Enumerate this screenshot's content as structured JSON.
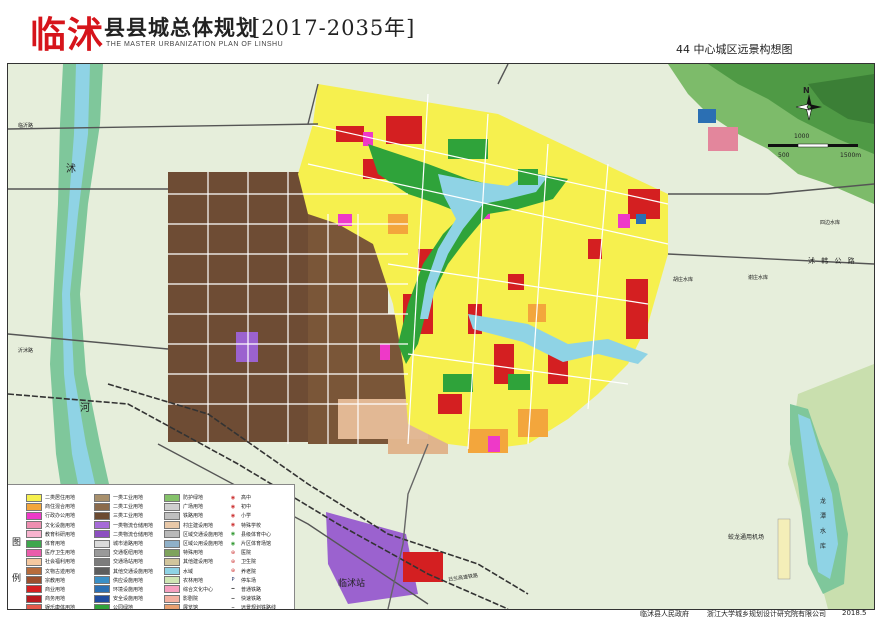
{
  "header": {
    "brand": "临沭",
    "title": "县县城总体规划",
    "subtitle": "THE MASTER URBANIZATION PLAN OF LINSHU",
    "years": "[2017-2035年]",
    "sheet": "44 中心城区远景构想图"
  },
  "map_labels": {
    "river_shu": "沭",
    "river_he": "河",
    "north_arrow": "N",
    "scale_1": "1000",
    "scale_0": "500",
    "scale_2": "1500m",
    "road_shuhan": "沭 韩 公 路",
    "road_linshu_station": "临沭站",
    "airport": "蛟龙通用机场",
    "reservoir_1": "龙",
    "reservoir_2": "潭",
    "reservoir_3": "水",
    "reservoir_4": "库",
    "xiecheng_reservoir": "谢庄水库",
    "hutuo_reservoir": "胡庄水库",
    "left_road_1": "临沂路",
    "left_road_2": "沂沭路",
    "place_sibian": "四边水库",
    "railway_label": "日兰高速铁路"
  },
  "legend": {
    "side_1": "图",
    "side_2": "例",
    "col1": [
      {
        "label": "二类居住用地",
        "color": "#f6f04e"
      },
      {
        "label": "商住混合用地",
        "color": "#f3a63c"
      },
      {
        "label": "行政办公用地",
        "color": "#ee39c8"
      },
      {
        "label": "文化设施用地",
        "color": "#ee8fb1"
      },
      {
        "label": "教育科研用地",
        "color": "#f7b3ce"
      },
      {
        "label": "体育用地",
        "color": "#3da74d"
      },
      {
        "label": "医疗卫生用地",
        "color": "#ea5dab"
      },
      {
        "label": "社会福利用地",
        "color": "#f6c9a0"
      },
      {
        "label": "文物古迹用地",
        "color": "#b76c3c"
      },
      {
        "label": "宗教用地",
        "color": "#9b4f2d"
      },
      {
        "label": "商业用地",
        "color": "#d41f21"
      },
      {
        "label": "商务用地",
        "color": "#b8191f"
      },
      {
        "label": "娱乐康体用地",
        "color": "#e4584a"
      },
      {
        "label": "公用设施营业网点用地",
        "color": "#c9443d"
      }
    ],
    "col2": [
      {
        "label": "一类工业用地",
        "color": "#a8906c"
      },
      {
        "label": "二类工业用地",
        "color": "#8b6b4c"
      },
      {
        "label": "三类工业用地",
        "color": "#6b4a31"
      },
      {
        "label": "一类物流仓储用地",
        "color": "#a66bd8"
      },
      {
        "label": "二类物流仓储用地",
        "color": "#8c4fc0"
      },
      {
        "label": "城市道路用地",
        "color": "#dadada"
      },
      {
        "label": "交通枢纽用地",
        "color": "#9a9a9a"
      },
      {
        "label": "交通场站用地",
        "color": "#7c7c7c"
      },
      {
        "label": "其他交通设施用地",
        "color": "#5d5d5d"
      },
      {
        "label": "供应设施用地",
        "color": "#3a8fc6"
      },
      {
        "label": "环境设施用地",
        "color": "#2b6fb3"
      },
      {
        "label": "安全设施用地",
        "color": "#1f4c9f"
      },
      {
        "label": "公园绿地",
        "color": "#2fa33a"
      }
    ],
    "col3": [
      {
        "label": "防护绿地",
        "color": "#85c26a"
      },
      {
        "label": "广场用地",
        "color": "#cfcfcf"
      },
      {
        "label": "铁路用地",
        "color": "#bfbfbf"
      },
      {
        "label": "村庄建设用地",
        "color": "#e8c8a8"
      },
      {
        "label": "区域交通设施用地",
        "color": "#b9b9b9"
      },
      {
        "label": "区域公用设施用地",
        "color": "#8fb0c8"
      },
      {
        "label": "特殊用地",
        "color": "#7ea35c"
      },
      {
        "label": "其他建设用地",
        "color": "#d2c59c"
      },
      {
        "label": "水域",
        "color": "#8fd3e5"
      },
      {
        "label": "农林用地",
        "color": "#cfe6b4"
      },
      {
        "label": "综合文化中心",
        "color": "#f6a0c0"
      },
      {
        "label": "影剧院",
        "color": "#f3b0a0"
      },
      {
        "label": "展览馆",
        "color": "#e8a070"
      }
    ],
    "col4": [
      {
        "label": "高中",
        "sym": "◉",
        "color": "#c33"
      },
      {
        "label": "初中",
        "sym": "◉",
        "color": "#c33"
      },
      {
        "label": "小学",
        "sym": "◉",
        "color": "#c33"
      },
      {
        "label": "特殊学校",
        "sym": "◉",
        "color": "#c33"
      },
      {
        "label": "县级体育中心",
        "sym": "◉",
        "color": "#393"
      },
      {
        "label": "片区体育场馆",
        "sym": "◉",
        "color": "#393"
      },
      {
        "label": "医院",
        "sym": "⊕",
        "color": "#c33"
      },
      {
        "label": "卫生院",
        "sym": "⊕",
        "color": "#c33"
      },
      {
        "label": "养老院",
        "sym": "⊕",
        "color": "#c33"
      },
      {
        "label": "停车场",
        "sym": "P",
        "color": "#236"
      },
      {
        "label": "普通铁路",
        "sym": "━",
        "color": "#333"
      },
      {
        "label": "快速铁路",
        "sym": "━",
        "color": "#555"
      },
      {
        "label": "远景规划铁路线",
        "sym": "┅",
        "color": "#555"
      }
    ]
  },
  "footer": {
    "org1": "临沭县人民政府",
    "org2": "浙江大学城乡规划设计研究院有限公司",
    "date": "2018.5"
  },
  "colors": {
    "residential": "#f6f04e",
    "commercial": "#d41f21",
    "industrial": "#6b4a31",
    "park": "#2fa33a",
    "water": "#8fd3e5",
    "farmland": "#dfe9d0",
    "brand_red": "#d6141b"
  }
}
